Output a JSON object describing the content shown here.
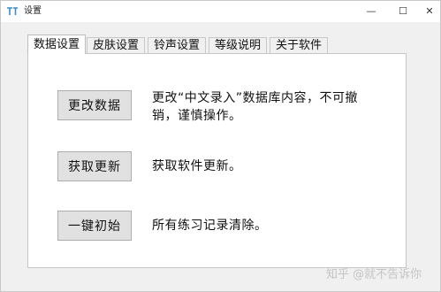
{
  "window": {
    "title": "设置",
    "minimize_glyph": "—",
    "maximize_glyph": "☐",
    "close_glyph": "✕"
  },
  "tabs": [
    {
      "label": "数据设置",
      "active": true
    },
    {
      "label": "皮肤设置",
      "active": false
    },
    {
      "label": "铃声设置",
      "active": false
    },
    {
      "label": "等级说明",
      "active": false
    },
    {
      "label": "关于软件",
      "active": false
    }
  ],
  "actions": [
    {
      "button": "更改数据",
      "description_line1": "更改“中文录入”数据库内容，不可撤",
      "description_line2": "销，谨慎操作。"
    },
    {
      "button": "获取更新",
      "description_line1": "获取软件更新。"
    },
    {
      "button": "一键初始",
      "description_line1": "所有练习记录清除。"
    }
  ],
  "watermark": "知乎 @就不告诉你",
  "colors": {
    "window_bg": "#f0f0f0",
    "panel_bg": "#ffffff",
    "button_bg": "#e1e1e1",
    "button_border": "#adadad",
    "app_icon": "#2f8fd8"
  }
}
